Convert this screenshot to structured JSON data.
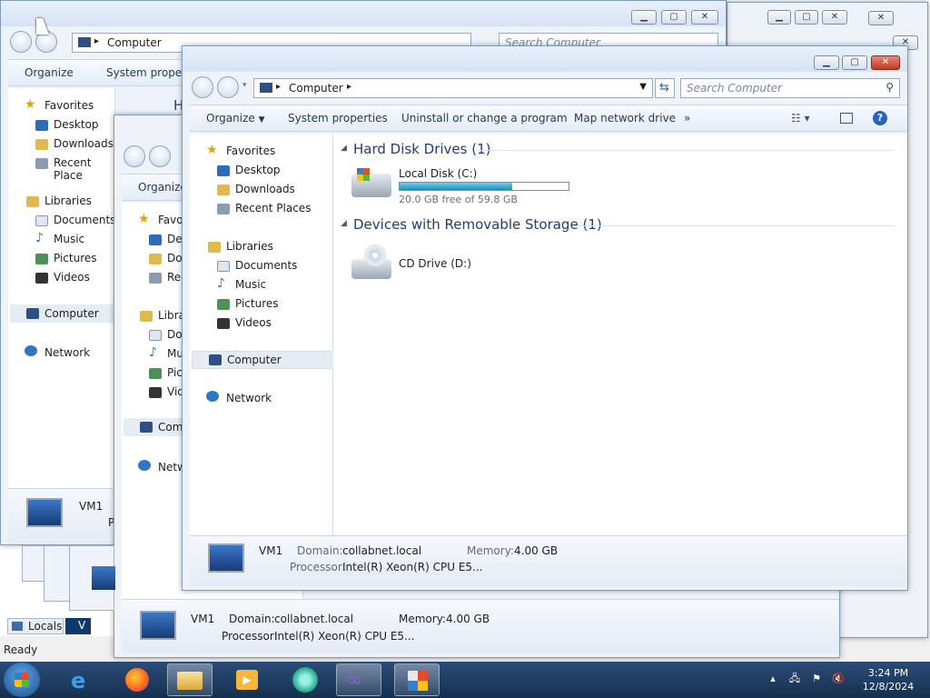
{
  "explorer": {
    "address": "Computer",
    "search_placeholder": "Search Computer",
    "toolbar": {
      "organize": "Organize",
      "system_properties": "System properties",
      "system_properties_cut": "System properti",
      "uninstall": "Uninstall or change a program",
      "map_drive": "Map network drive",
      "more": "»"
    },
    "nav": {
      "favorites": "Favorites",
      "desktop": "Desktop",
      "downloads": "Downloads",
      "recent": "Recent Places",
      "recent_cut": "Recent Place",
      "libraries": "Libraries",
      "documents": "Documents",
      "music": "Music",
      "pictures": "Pictures",
      "videos": "Videos",
      "computer": "Computer",
      "network": "Network"
    },
    "sections": {
      "hdd": "Hard Disk Drives (1)",
      "removable": "Devices with Removable Storage (1)"
    },
    "drives": {
      "c_name": "Local Disk (C:)",
      "c_free": "20.0 GB free of 59.8 GB",
      "c_used_fraction": 0.666,
      "d_name": "CD Drive (D:)"
    },
    "details": {
      "name": "VM1",
      "domain_label": "Domain:",
      "domain_value": "collabnet.local",
      "memory_label": "Memory:",
      "memory_value": "4.00 GB",
      "processor_label": "Processor:",
      "processor_value": "Intel(R) Xeon(R) CPU E5..."
    }
  },
  "back_window": {
    "heading_cut": "H",
    "partial": {
      "des": "Des",
      "dov": "Dov",
      "rec": "Rec",
      "libra": "Libra",
      "do": "Do",
      "mu": "Mu",
      "pic": "Pic",
      "vid": "Vid",
      "com": "Com",
      "netw": "Netw",
      "fav": "Favo",
      "organize": "Organize",
      "p": "P"
    }
  },
  "app_status": {
    "ready": "Ready",
    "locals_tab": "Locals",
    "v_tab": "V"
  },
  "taskbar": {
    "time": "3:24 PM",
    "date": "12/8/2024"
  },
  "colors": {
    "taskbar": "#1f3d66",
    "accent_link": "#1e3e7a",
    "close_red": "#c13a23"
  }
}
